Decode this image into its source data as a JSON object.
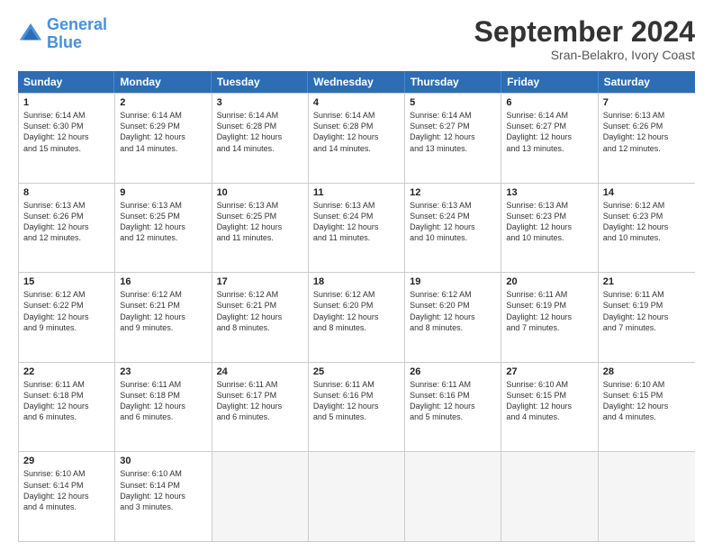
{
  "header": {
    "logo_line1": "General",
    "logo_line2": "Blue",
    "month": "September 2024",
    "location": "Sran-Belakro, Ivory Coast"
  },
  "days_of_week": [
    "Sunday",
    "Monday",
    "Tuesday",
    "Wednesday",
    "Thursday",
    "Friday",
    "Saturday"
  ],
  "weeks": [
    [
      {
        "day": "1",
        "lines": [
          "Sunrise: 6:14 AM",
          "Sunset: 6:30 PM",
          "Daylight: 12 hours",
          "and 15 minutes."
        ]
      },
      {
        "day": "2",
        "lines": [
          "Sunrise: 6:14 AM",
          "Sunset: 6:29 PM",
          "Daylight: 12 hours",
          "and 14 minutes."
        ]
      },
      {
        "day": "3",
        "lines": [
          "Sunrise: 6:14 AM",
          "Sunset: 6:28 PM",
          "Daylight: 12 hours",
          "and 14 minutes."
        ]
      },
      {
        "day": "4",
        "lines": [
          "Sunrise: 6:14 AM",
          "Sunset: 6:28 PM",
          "Daylight: 12 hours",
          "and 14 minutes."
        ]
      },
      {
        "day": "5",
        "lines": [
          "Sunrise: 6:14 AM",
          "Sunset: 6:27 PM",
          "Daylight: 12 hours",
          "and 13 minutes."
        ]
      },
      {
        "day": "6",
        "lines": [
          "Sunrise: 6:14 AM",
          "Sunset: 6:27 PM",
          "Daylight: 12 hours",
          "and 13 minutes."
        ]
      },
      {
        "day": "7",
        "lines": [
          "Sunrise: 6:13 AM",
          "Sunset: 6:26 PM",
          "Daylight: 12 hours",
          "and 12 minutes."
        ]
      }
    ],
    [
      {
        "day": "8",
        "lines": [
          "Sunrise: 6:13 AM",
          "Sunset: 6:26 PM",
          "Daylight: 12 hours",
          "and 12 minutes."
        ]
      },
      {
        "day": "9",
        "lines": [
          "Sunrise: 6:13 AM",
          "Sunset: 6:25 PM",
          "Daylight: 12 hours",
          "and 12 minutes."
        ]
      },
      {
        "day": "10",
        "lines": [
          "Sunrise: 6:13 AM",
          "Sunset: 6:25 PM",
          "Daylight: 12 hours",
          "and 11 minutes."
        ]
      },
      {
        "day": "11",
        "lines": [
          "Sunrise: 6:13 AM",
          "Sunset: 6:24 PM",
          "Daylight: 12 hours",
          "and 11 minutes."
        ]
      },
      {
        "day": "12",
        "lines": [
          "Sunrise: 6:13 AM",
          "Sunset: 6:24 PM",
          "Daylight: 12 hours",
          "and 10 minutes."
        ]
      },
      {
        "day": "13",
        "lines": [
          "Sunrise: 6:13 AM",
          "Sunset: 6:23 PM",
          "Daylight: 12 hours",
          "and 10 minutes."
        ]
      },
      {
        "day": "14",
        "lines": [
          "Sunrise: 6:12 AM",
          "Sunset: 6:23 PM",
          "Daylight: 12 hours",
          "and 10 minutes."
        ]
      }
    ],
    [
      {
        "day": "15",
        "lines": [
          "Sunrise: 6:12 AM",
          "Sunset: 6:22 PM",
          "Daylight: 12 hours",
          "and 9 minutes."
        ]
      },
      {
        "day": "16",
        "lines": [
          "Sunrise: 6:12 AM",
          "Sunset: 6:21 PM",
          "Daylight: 12 hours",
          "and 9 minutes."
        ]
      },
      {
        "day": "17",
        "lines": [
          "Sunrise: 6:12 AM",
          "Sunset: 6:21 PM",
          "Daylight: 12 hours",
          "and 8 minutes."
        ]
      },
      {
        "day": "18",
        "lines": [
          "Sunrise: 6:12 AM",
          "Sunset: 6:20 PM",
          "Daylight: 12 hours",
          "and 8 minutes."
        ]
      },
      {
        "day": "19",
        "lines": [
          "Sunrise: 6:12 AM",
          "Sunset: 6:20 PM",
          "Daylight: 12 hours",
          "and 8 minutes."
        ]
      },
      {
        "day": "20",
        "lines": [
          "Sunrise: 6:11 AM",
          "Sunset: 6:19 PM",
          "Daylight: 12 hours",
          "and 7 minutes."
        ]
      },
      {
        "day": "21",
        "lines": [
          "Sunrise: 6:11 AM",
          "Sunset: 6:19 PM",
          "Daylight: 12 hours",
          "and 7 minutes."
        ]
      }
    ],
    [
      {
        "day": "22",
        "lines": [
          "Sunrise: 6:11 AM",
          "Sunset: 6:18 PM",
          "Daylight: 12 hours",
          "and 6 minutes."
        ]
      },
      {
        "day": "23",
        "lines": [
          "Sunrise: 6:11 AM",
          "Sunset: 6:18 PM",
          "Daylight: 12 hours",
          "and 6 minutes."
        ]
      },
      {
        "day": "24",
        "lines": [
          "Sunrise: 6:11 AM",
          "Sunset: 6:17 PM",
          "Daylight: 12 hours",
          "and 6 minutes."
        ]
      },
      {
        "day": "25",
        "lines": [
          "Sunrise: 6:11 AM",
          "Sunset: 6:16 PM",
          "Daylight: 12 hours",
          "and 5 minutes."
        ]
      },
      {
        "day": "26",
        "lines": [
          "Sunrise: 6:11 AM",
          "Sunset: 6:16 PM",
          "Daylight: 12 hours",
          "and 5 minutes."
        ]
      },
      {
        "day": "27",
        "lines": [
          "Sunrise: 6:10 AM",
          "Sunset: 6:15 PM",
          "Daylight: 12 hours",
          "and 4 minutes."
        ]
      },
      {
        "day": "28",
        "lines": [
          "Sunrise: 6:10 AM",
          "Sunset: 6:15 PM",
          "Daylight: 12 hours",
          "and 4 minutes."
        ]
      }
    ],
    [
      {
        "day": "29",
        "lines": [
          "Sunrise: 6:10 AM",
          "Sunset: 6:14 PM",
          "Daylight: 12 hours",
          "and 4 minutes."
        ]
      },
      {
        "day": "30",
        "lines": [
          "Sunrise: 6:10 AM",
          "Sunset: 6:14 PM",
          "Daylight: 12 hours",
          "and 3 minutes."
        ]
      },
      {
        "day": "",
        "lines": []
      },
      {
        "day": "",
        "lines": []
      },
      {
        "day": "",
        "lines": []
      },
      {
        "day": "",
        "lines": []
      },
      {
        "day": "",
        "lines": []
      }
    ]
  ]
}
